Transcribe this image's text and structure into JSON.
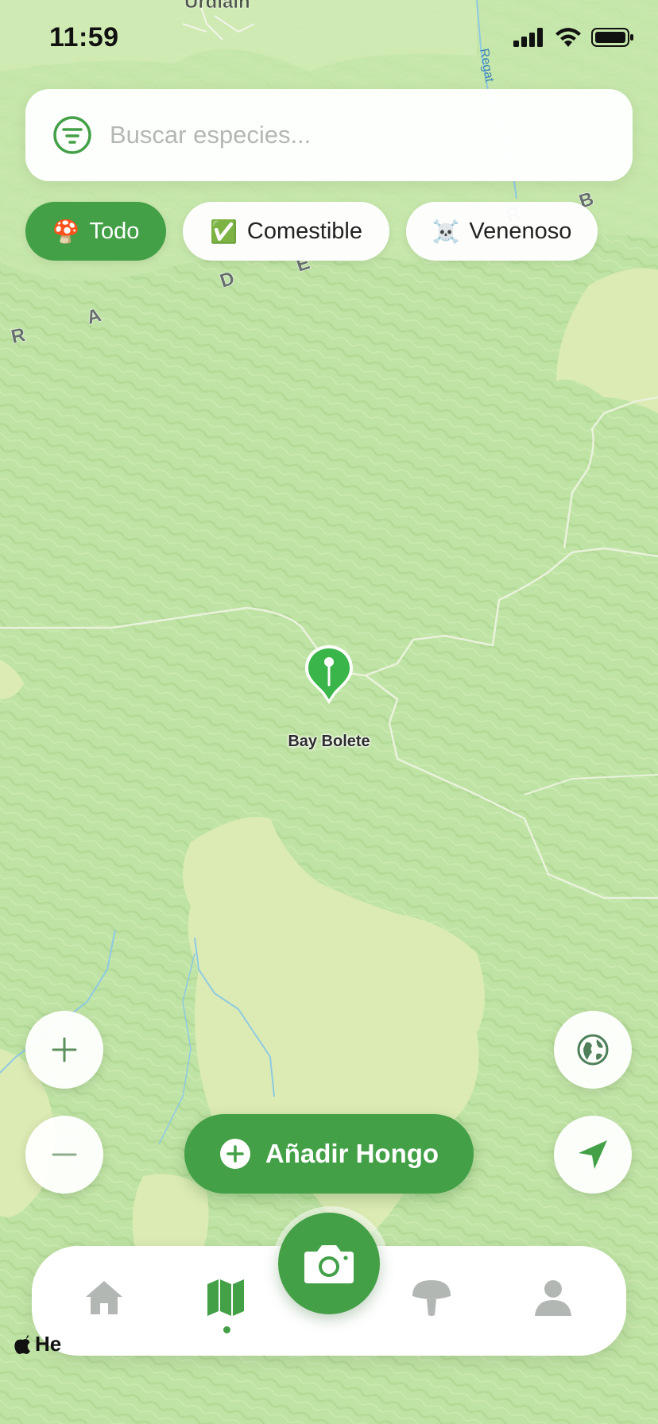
{
  "status_bar": {
    "time": "11:59"
  },
  "map": {
    "labels": {
      "town": "Urdiain",
      "river": "Regat",
      "range_letters": [
        "R",
        "A",
        "D",
        "E",
        "R",
        "B"
      ]
    },
    "pin": {
      "label": "Bay Bolete"
    },
    "attribution": "He"
  },
  "search": {
    "placeholder": "Buscar especies..."
  },
  "filters": [
    {
      "emoji": "🍄",
      "label": "Todo",
      "active": true
    },
    {
      "emoji": "✅",
      "label": "Comestible",
      "active": false
    },
    {
      "emoji": "☠️",
      "label": "Venenoso",
      "active": false
    }
  ],
  "add_button": {
    "label": "Añadir Hongo"
  },
  "colors": {
    "accent": "#43a047",
    "map_base": "#bfe3a4",
    "map_light": "#dcebb4"
  },
  "icons": {
    "zoom_in": "plus-icon",
    "zoom_out": "minus-icon",
    "globe": "globe-icon",
    "locate": "location-arrow-icon",
    "camera": "camera-icon",
    "tabs": [
      "home-icon",
      "map-icon",
      "mushroom-icon",
      "profile-icon"
    ]
  },
  "tabbar": {
    "active_tab": "map"
  }
}
